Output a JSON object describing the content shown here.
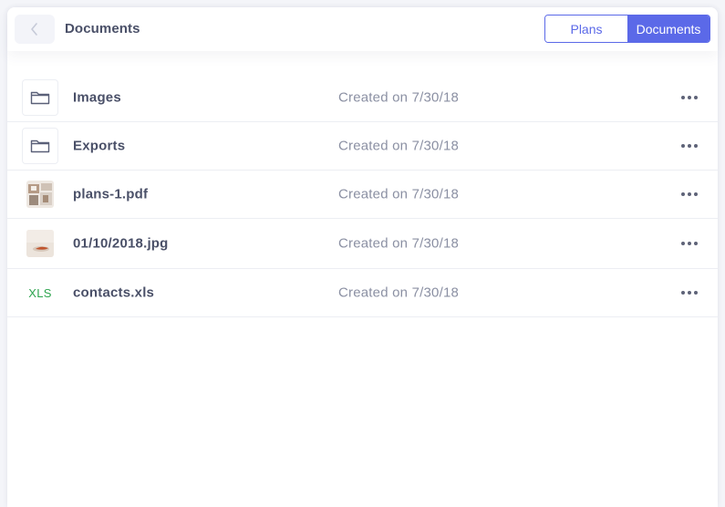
{
  "header": {
    "title": "Documents",
    "tabs": [
      {
        "label": "Plans",
        "active": false
      },
      {
        "label": "Documents",
        "active": true
      }
    ]
  },
  "files": [
    {
      "name": "Images",
      "created": "Created on 7/30/18",
      "kind": "folder",
      "icon": "folder-icon"
    },
    {
      "name": "Exports",
      "created": "Created on 7/30/18",
      "kind": "folder",
      "icon": "folder-icon"
    },
    {
      "name": "plans-1.pdf",
      "created": "Created on 7/30/18",
      "kind": "pdf",
      "icon": "pdf-thumbnail"
    },
    {
      "name": "01/10/2018.jpg",
      "created": "Created on 7/30/18",
      "kind": "jpg",
      "icon": "image-thumbnail"
    },
    {
      "name": "contacts.xls",
      "created": "Created on 7/30/18",
      "kind": "xls",
      "icon": "xls-icon",
      "badge": "XLS"
    }
  ],
  "colors": {
    "accent": "#5b69e8",
    "text_primary": "#4a5068",
    "text_secondary": "#8b90a3",
    "xls_green": "#2ea44f",
    "divider": "#eceef3"
  }
}
